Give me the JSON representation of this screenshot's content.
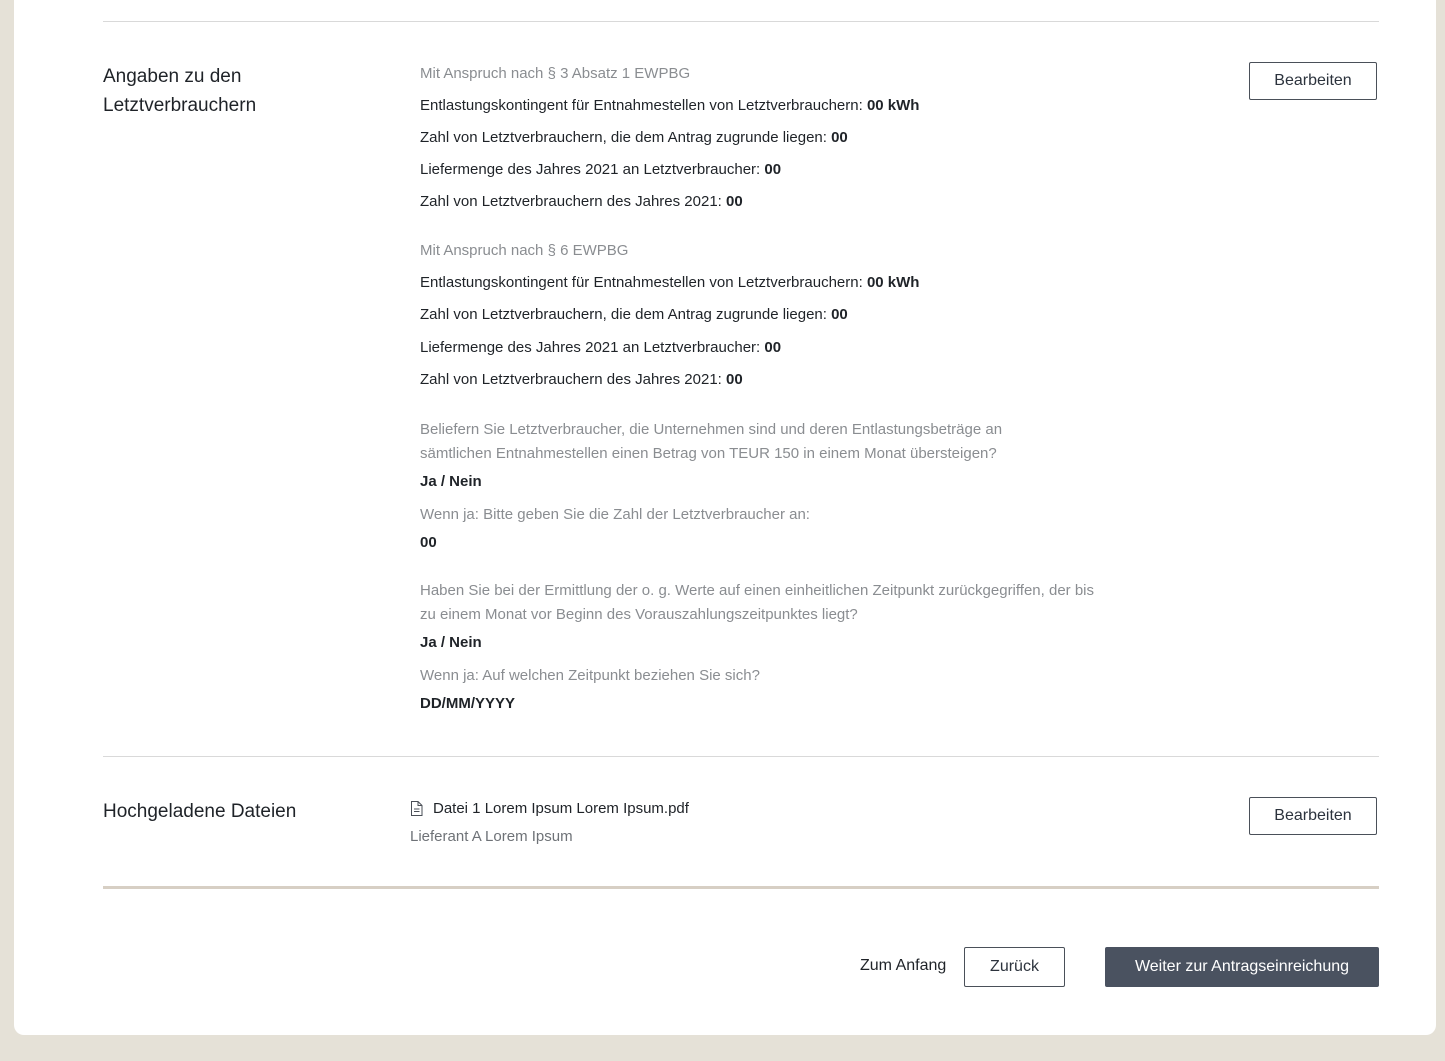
{
  "section_consumers": {
    "title_line1": "Angaben zu den",
    "title_line2": "Letztverbrauchern",
    "edit_label": "Bearbeiten",
    "group1": {
      "heading": "Mit Anspruch nach § 3 Absatz 1 EWPBG",
      "row1_label": "Entlastungskontingent für Entnahmestellen von Letztverbrauchern: ",
      "row1_value": "00 kWh",
      "row2_label": "Zahl von Letztverbrauchern, die dem Antrag zugrunde liegen: ",
      "row2_value": "00",
      "row3_label": "Liefermenge des Jahres 2021 an Letztverbraucher: ",
      "row3_value": "00",
      "row4_label": "Zahl von Letztverbrauchern des Jahres 2021: ",
      "row4_value": "00"
    },
    "group2": {
      "heading": "Mit Anspruch nach § 6 EWPBG",
      "row1_label": "Entlastungskontingent für Entnahmestellen von Letztverbrauchern: ",
      "row1_value": "00 kWh",
      "row2_label": "Zahl von Letztverbrauchern, die dem Antrag zugrunde liegen: ",
      "row2_value": "00",
      "row3_label": "Liefermenge des Jahres 2021 an Letztverbraucher: ",
      "row3_value": "00",
      "row4_label": "Zahl von Letztverbrauchern des Jahres 2021: ",
      "row4_value": "00"
    },
    "question1": {
      "text": "Beliefern Sie Letztverbraucher, die Unternehmen sind und deren Entlastungsbeträge an sämtlichen Entnahmestellen einen Betrag von TEUR 150 in einem Monat übersteigen?",
      "answer": "Ja / Nein",
      "followup": "Wenn ja: Bitte geben Sie die Zahl der Letztverbraucher an:",
      "followup_answer": "00"
    },
    "question2": {
      "text": "Haben Sie bei der Ermittlung der o. g. Werte auf einen einheitlichen Zeitpunkt zurückgegriffen, der bis zu einem Monat vor Beginn des Vorauszahlungszeitpunktes liegt?",
      "answer": "Ja / Nein",
      "followup": "Wenn ja: Auf welchen Zeitpunkt beziehen Sie sich?",
      "followup_answer": "DD/MM/YYYY"
    }
  },
  "section_files": {
    "title": "Hochgeladene Dateien",
    "edit_label": "Bearbeiten",
    "file_name": "Datei 1 Lorem Ipsum Lorem Ipsum.pdf",
    "file_supplier": "Lieferant A Lorem Ipsum",
    "file_icon": "document-icon"
  },
  "footer": {
    "to_start": "Zum Anfang",
    "back": "Zurück",
    "next": "Weiter zur Antragseinreichung"
  }
}
